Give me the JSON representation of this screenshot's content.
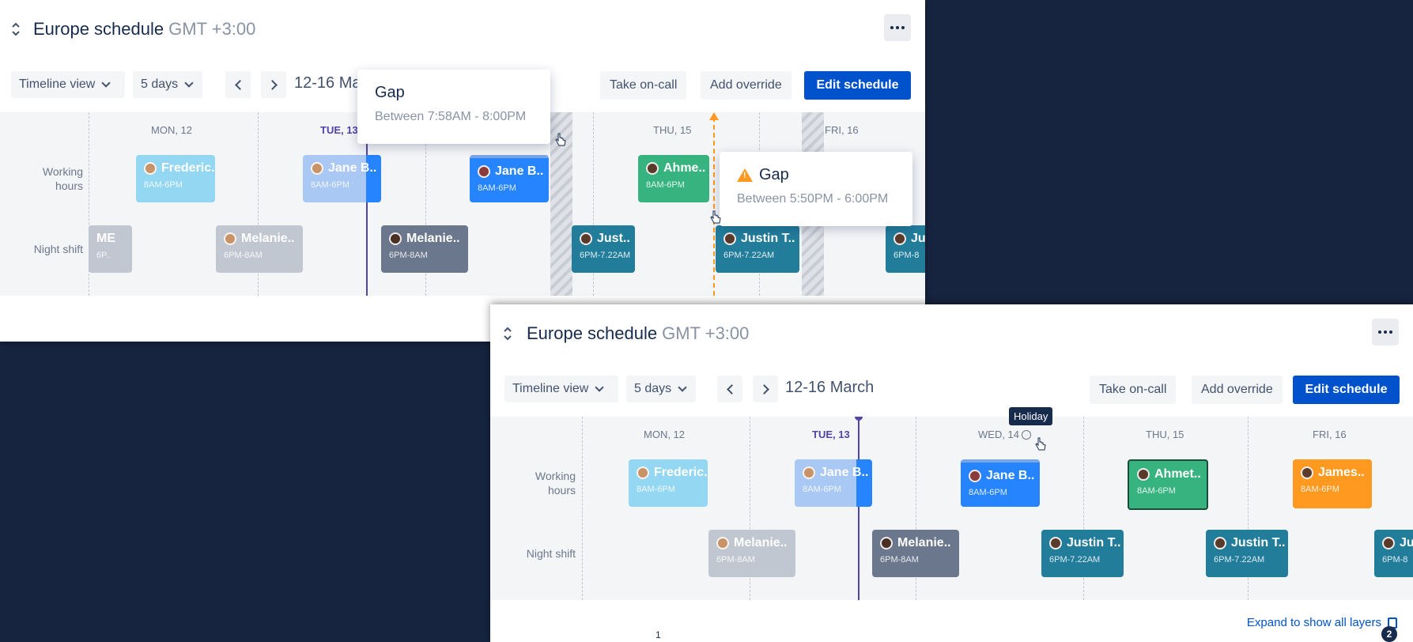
{
  "panel1": {
    "title": "Europe schedule",
    "timezone": "GMT +3:00",
    "view_select": "Timeline view",
    "days_select": "5 days",
    "date_range": "12-16 Ma",
    "actions": {
      "take_oncall": "Take on-call",
      "add_override": "Add override",
      "edit_schedule": "Edit schedule"
    },
    "days": [
      "MON, 12",
      "TUE, 13",
      "THU, 15",
      "FRI, 16"
    ],
    "rows": {
      "working": "Working\nhours",
      "night": "Night shift"
    },
    "working_shifts": [
      {
        "name": "Frederic..",
        "time": "8AM-6PM"
      },
      {
        "name": "Jane B..",
        "time": "8AM-6PM"
      },
      {
        "name": "Jane B..",
        "time": "8AM-6PM"
      },
      {
        "name": "Ahme..",
        "time": "8AM-6PM"
      }
    ],
    "night_shifts": [
      {
        "name": "ME",
        "time": "6P.."
      },
      {
        "name": "Melanie..",
        "time": "6PM-8AM"
      },
      {
        "name": "Melanie..",
        "time": "6PM-8AM"
      },
      {
        "name": "Just..",
        "time": "6PM-7.22AM"
      },
      {
        "name": "Justin T..",
        "time": "6PM-7.22AM"
      },
      {
        "name": "Ju",
        "time": "6PM-8"
      }
    ],
    "gap_tooltip_1": {
      "title": "Gap",
      "subtitle": "Between 7:58AM - 8:00PM"
    },
    "gap_tooltip_2": {
      "title": "Gap",
      "subtitle": "Between 5:50PM - 6:00PM"
    }
  },
  "panel2": {
    "title": "Europe schedule",
    "timezone": "GMT +3:00",
    "view_select": "Timeline view",
    "days_select": "5 days",
    "date_range": "12-16 March",
    "actions": {
      "take_oncall": "Take on-call",
      "add_override": "Add override",
      "edit_schedule": "Edit schedule"
    },
    "days": [
      "MON, 12",
      "TUE, 13",
      "WED, 14",
      "THU, 15",
      "FRI, 16"
    ],
    "rows": {
      "working": "Working\nhours",
      "night": "Night shift"
    },
    "holiday_tooltip": "Holiday",
    "working_shifts": [
      {
        "name": "Frederic..",
        "time": "8AM-6PM"
      },
      {
        "name": "Jane B..",
        "time": "8AM-6PM"
      },
      {
        "name": "Jane B..",
        "time": "8AM-6PM"
      },
      {
        "name": "Ahmet..",
        "time": "8AM-6PM"
      },
      {
        "name": "James..",
        "time": "8AM-6PM"
      }
    ],
    "night_shifts": [
      {
        "name": "Melanie..",
        "time": "6PM-8AM"
      },
      {
        "name": "Melanie..",
        "time": "6PM-8AM"
      },
      {
        "name": "Justin T..",
        "time": "6PM-7.22AM"
      },
      {
        "name": "Justin T..",
        "time": "6PM-7.22AM"
      },
      {
        "name": "Ju",
        "time": "6PM-8"
      }
    ],
    "expand_link": "Expand to show all layers"
  },
  "annotations": {
    "label_1": "1",
    "label_2": "2"
  },
  "colors": {
    "primary": "#0052cc",
    "today": "#5243aa",
    "warning": "#ff991f",
    "page_bg": "#172440"
  }
}
